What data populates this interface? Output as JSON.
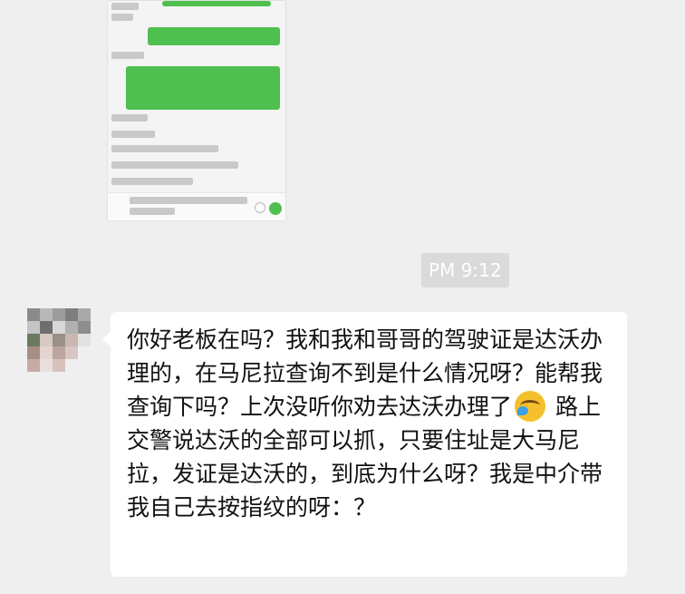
{
  "thumbnail": {
    "description_icons": [
      "send-icon",
      "emoji-icon"
    ]
  },
  "chat": {
    "timestamp": "PM 9:12",
    "message": {
      "text_part1": "你好老板在吗？我和我和哥哥的驾驶证是达沃办理的，在马尼拉查询不到是什么情况呀？能帮我查询下吗？上次没听你劝去达沃办理了",
      "emoji": "face-with-tears-of-joy-icon",
      "text_part2": " 路上交警说达沃的全部可以抓，只要住址是大马尼拉，发证是达沃的，到底为什么呀？我是中介带我自己去按指纹的呀：？"
    }
  },
  "colors": {
    "background": "#efefef",
    "bubble": "#ffffff",
    "timestamp_bg": "#dadada",
    "accent_green": "#4fbf4f"
  }
}
